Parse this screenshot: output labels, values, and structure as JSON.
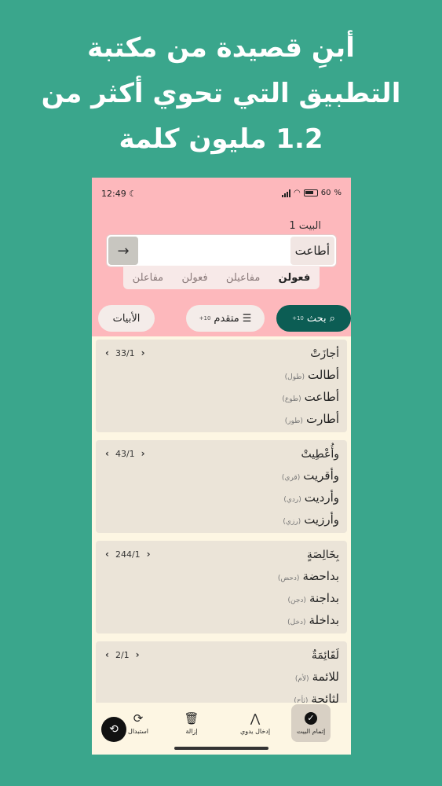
{
  "promo": {
    "lines": [
      "أبنِ قصيدة من مكتبة",
      "التطبيق التي تحوي أكثر من",
      "1.2 مليون كلمة"
    ]
  },
  "status": {
    "time": "12:49",
    "battery": "60"
  },
  "editor": {
    "verse_label": "البيت 1",
    "current_word": "أطاعت",
    "meters": [
      "فعولن",
      "مفاعيلن",
      "فعولن",
      "مفاعلن"
    ]
  },
  "actions": {
    "search": "بحث",
    "search_badge": "10+",
    "advanced": "متقدم",
    "advanced_badge": "10+",
    "verses": "الأبيات"
  },
  "results": [
    {
      "title": "أجازَتْ",
      "count": "33/1",
      "rows": [
        {
          "word": "أطالت",
          "root": "(طول)"
        },
        {
          "word": "أطاعت",
          "root": "(طوع)"
        },
        {
          "word": "أطارت",
          "root": "(طور)"
        }
      ]
    },
    {
      "title": "وأُعْطِيتْ",
      "count": "43/1",
      "rows": [
        {
          "word": "وأقريت",
          "root": "(قري)"
        },
        {
          "word": "وأرديت",
          "root": "(ردي)"
        },
        {
          "word": "وأرزيت",
          "root": "(رزي)"
        }
      ]
    },
    {
      "title": "بِخَالِصَةٍ",
      "count": "244/1",
      "rows": [
        {
          "word": "بداحضة",
          "root": "(دحض)"
        },
        {
          "word": "بداجنة",
          "root": "(دجن)"
        },
        {
          "word": "بداخلة",
          "root": "(دخل)"
        }
      ]
    },
    {
      "title": "لَقَائِمَةٌ",
      "count": "2/1",
      "rows": [
        {
          "word": "للائمة",
          "root": "(لأم)"
        },
        {
          "word": "لثائحة",
          "root": "(ثأح)"
        }
      ]
    }
  ],
  "bottom_nav": {
    "complete": "إتمام البيت",
    "manual": "إدخال يدوي",
    "remove": "إزالة",
    "restore": "استبدال"
  },
  "icons": {
    "arrow": "arrow-right-icon",
    "search": "search-icon",
    "advanced": "advanced-search-icon",
    "complete": "check-circle-icon",
    "manual": "compass-icon",
    "remove": "trash-icon",
    "restore": "restore-icon"
  },
  "colors": {
    "background": "#3aa68c",
    "header_pink": "#fdb8bc",
    "primary": "#0c5d54",
    "card": "#ebe4d8",
    "surface": "#fdf6e3"
  }
}
